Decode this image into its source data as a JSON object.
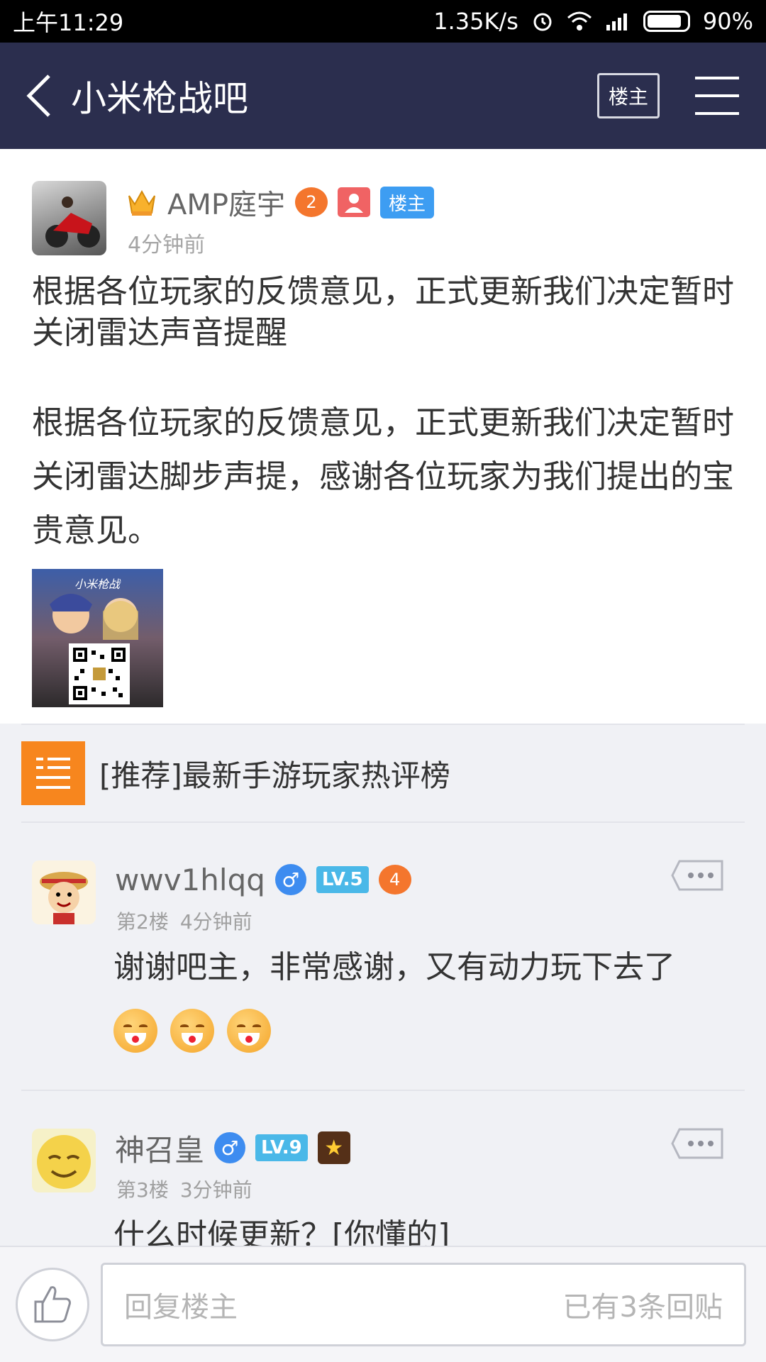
{
  "status_bar": {
    "time": "上午11:29",
    "speed": "1.35K/s",
    "battery": "90%"
  },
  "nav": {
    "title": "小米枪战吧",
    "louzhu_button": "楼主"
  },
  "post": {
    "author": "AMP庭宇",
    "game_level": "2",
    "badge": "楼主",
    "time": "4分钟前",
    "title": "根据各位玩家的反馈意见，正式更新我们决定暂时关闭雷达声音提醒",
    "body": "根据各位玩家的反馈意见，正式更新我们决定暂时关闭雷达脚步声提，感谢各位玩家为我们提出的宝贵意见。",
    "image_caption": "小米枪战"
  },
  "recommend": {
    "text": "[推荐]最新手游玩家热评榜"
  },
  "replies": [
    {
      "name": "wwv1hlqq",
      "gender": "♂",
      "level": "LV.5",
      "game_level": "4",
      "floor": "第2楼",
      "time": "4分钟前",
      "content": "谢谢吧主，非常感谢，又有动力玩下去了"
    },
    {
      "name": "神召皇",
      "gender": "♂",
      "level": "LV.9",
      "floor": "第3楼",
      "time": "3分钟前",
      "content": "什么时候更新？[你懂的]"
    }
  ],
  "bottom": {
    "placeholder": "回复楼主",
    "count": "已有3条回贴"
  },
  "colors": {
    "nav_bg": "#2b2e4e",
    "badge_blue": "#3d9df2",
    "recommend_orange": "#f7861e",
    "level_blue": "#4ab8e8"
  },
  "icons": [
    "back-arrow-icon",
    "menu-icon",
    "crown-icon",
    "gamepad-badge-icon",
    "person-icon",
    "more-dots-icon",
    "thumbs-up-icon",
    "list-icon"
  ]
}
